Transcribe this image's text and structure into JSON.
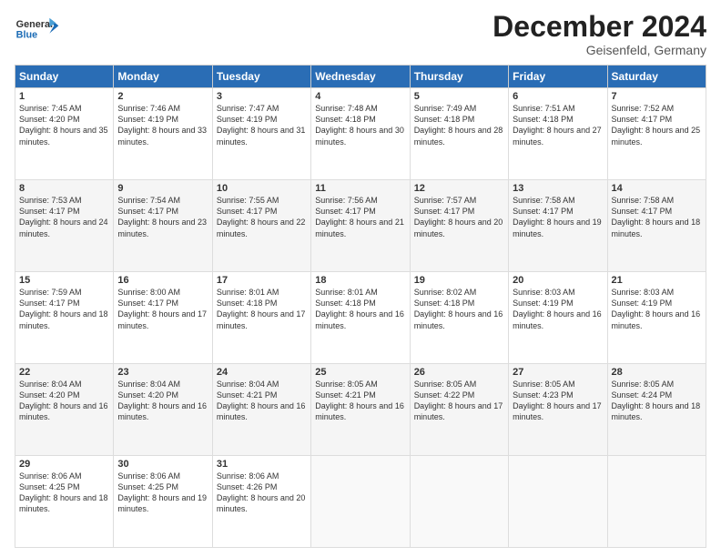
{
  "header": {
    "logo_general": "General",
    "logo_blue": "Blue",
    "month_title": "December 2024",
    "location": "Geisenfeld, Germany"
  },
  "days_of_week": [
    "Sunday",
    "Monday",
    "Tuesday",
    "Wednesday",
    "Thursday",
    "Friday",
    "Saturday"
  ],
  "weeks": [
    [
      {
        "day": "1",
        "sunrise": "7:45 AM",
        "sunset": "4:20 PM",
        "daylight": "8 hours and 35 minutes."
      },
      {
        "day": "2",
        "sunrise": "7:46 AM",
        "sunset": "4:19 PM",
        "daylight": "8 hours and 33 minutes."
      },
      {
        "day": "3",
        "sunrise": "7:47 AM",
        "sunset": "4:19 PM",
        "daylight": "8 hours and 31 minutes."
      },
      {
        "day": "4",
        "sunrise": "7:48 AM",
        "sunset": "4:18 PM",
        "daylight": "8 hours and 30 minutes."
      },
      {
        "day": "5",
        "sunrise": "7:49 AM",
        "sunset": "4:18 PM",
        "daylight": "8 hours and 28 minutes."
      },
      {
        "day": "6",
        "sunrise": "7:51 AM",
        "sunset": "4:18 PM",
        "daylight": "8 hours and 27 minutes."
      },
      {
        "day": "7",
        "sunrise": "7:52 AM",
        "sunset": "4:17 PM",
        "daylight": "8 hours and 25 minutes."
      }
    ],
    [
      {
        "day": "8",
        "sunrise": "7:53 AM",
        "sunset": "4:17 PM",
        "daylight": "8 hours and 24 minutes."
      },
      {
        "day": "9",
        "sunrise": "7:54 AM",
        "sunset": "4:17 PM",
        "daylight": "8 hours and 23 minutes."
      },
      {
        "day": "10",
        "sunrise": "7:55 AM",
        "sunset": "4:17 PM",
        "daylight": "8 hours and 22 minutes."
      },
      {
        "day": "11",
        "sunrise": "7:56 AM",
        "sunset": "4:17 PM",
        "daylight": "8 hours and 21 minutes."
      },
      {
        "day": "12",
        "sunrise": "7:57 AM",
        "sunset": "4:17 PM",
        "daylight": "8 hours and 20 minutes."
      },
      {
        "day": "13",
        "sunrise": "7:58 AM",
        "sunset": "4:17 PM",
        "daylight": "8 hours and 19 minutes."
      },
      {
        "day": "14",
        "sunrise": "7:58 AM",
        "sunset": "4:17 PM",
        "daylight": "8 hours and 18 minutes."
      }
    ],
    [
      {
        "day": "15",
        "sunrise": "7:59 AM",
        "sunset": "4:17 PM",
        "daylight": "8 hours and 18 minutes."
      },
      {
        "day": "16",
        "sunrise": "8:00 AM",
        "sunset": "4:17 PM",
        "daylight": "8 hours and 17 minutes."
      },
      {
        "day": "17",
        "sunrise": "8:01 AM",
        "sunset": "4:18 PM",
        "daylight": "8 hours and 17 minutes."
      },
      {
        "day": "18",
        "sunrise": "8:01 AM",
        "sunset": "4:18 PM",
        "daylight": "8 hours and 16 minutes."
      },
      {
        "day": "19",
        "sunrise": "8:02 AM",
        "sunset": "4:18 PM",
        "daylight": "8 hours and 16 minutes."
      },
      {
        "day": "20",
        "sunrise": "8:03 AM",
        "sunset": "4:19 PM",
        "daylight": "8 hours and 16 minutes."
      },
      {
        "day": "21",
        "sunrise": "8:03 AM",
        "sunset": "4:19 PM",
        "daylight": "8 hours and 16 minutes."
      }
    ],
    [
      {
        "day": "22",
        "sunrise": "8:04 AM",
        "sunset": "4:20 PM",
        "daylight": "8 hours and 16 minutes."
      },
      {
        "day": "23",
        "sunrise": "8:04 AM",
        "sunset": "4:20 PM",
        "daylight": "8 hours and 16 minutes."
      },
      {
        "day": "24",
        "sunrise": "8:04 AM",
        "sunset": "4:21 PM",
        "daylight": "8 hours and 16 minutes."
      },
      {
        "day": "25",
        "sunrise": "8:05 AM",
        "sunset": "4:21 PM",
        "daylight": "8 hours and 16 minutes."
      },
      {
        "day": "26",
        "sunrise": "8:05 AM",
        "sunset": "4:22 PM",
        "daylight": "8 hours and 17 minutes."
      },
      {
        "day": "27",
        "sunrise": "8:05 AM",
        "sunset": "4:23 PM",
        "daylight": "8 hours and 17 minutes."
      },
      {
        "day": "28",
        "sunrise": "8:05 AM",
        "sunset": "4:24 PM",
        "daylight": "8 hours and 18 minutes."
      }
    ],
    [
      {
        "day": "29",
        "sunrise": "8:06 AM",
        "sunset": "4:25 PM",
        "daylight": "8 hours and 18 minutes."
      },
      {
        "day": "30",
        "sunrise": "8:06 AM",
        "sunset": "4:25 PM",
        "daylight": "8 hours and 19 minutes."
      },
      {
        "day": "31",
        "sunrise": "8:06 AM",
        "sunset": "4:26 PM",
        "daylight": "8 hours and 20 minutes."
      },
      null,
      null,
      null,
      null
    ]
  ]
}
